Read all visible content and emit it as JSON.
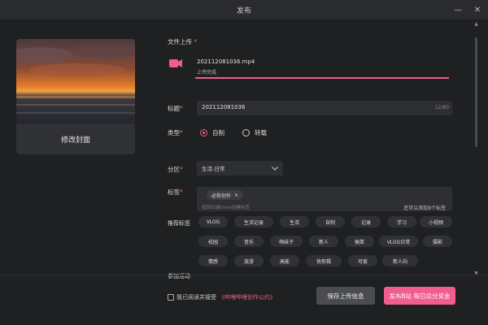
{
  "window": {
    "title": "发布"
  },
  "cover": {
    "label": "修改封面"
  },
  "upload": {
    "label": "文件上传",
    "required_mark": "*",
    "file_name": "202112081036.mp4",
    "status": "上传完成",
    "progress_percent": 100
  },
  "title_field": {
    "label": "标题",
    "value": "202112081036",
    "count": "12/80"
  },
  "type_field": {
    "label": "类型",
    "options": [
      "自制",
      "转载"
    ],
    "selected": "自制"
  },
  "section_field": {
    "label": "分区",
    "value": "生活-日常"
  },
  "tags_field": {
    "label": "标签",
    "chip": "必剪创作",
    "placeholder": "按回车键Enter创建标签",
    "hint": "还可以添加9个标签"
  },
  "recommended": {
    "label": "推荐标签",
    "rows": [
      [
        "VLOG",
        "生活记录",
        "生活",
        "自制",
        "记录",
        "学习",
        "小视频"
      ],
      [
        "校园",
        "音乐",
        "萌妹子",
        "新人",
        "搞笑",
        "VLOG日常",
        "摄影"
      ],
      [
        "情感",
        "旅游",
        "高能",
        "快剪辑",
        "可爱",
        "新人向"
      ]
    ]
  },
  "activity": {
    "label": "参加活动"
  },
  "footer": {
    "agree_text": "我已阅读并接受",
    "agree_link": "《哔哩哔哩创作公约》",
    "save_label": "保存上传信息",
    "publish_label": "发布B站 每日瓜分奖金"
  },
  "colors": {
    "accent": "#f25d8e",
    "background": "#1f2022",
    "panel": "#2e2f33"
  }
}
